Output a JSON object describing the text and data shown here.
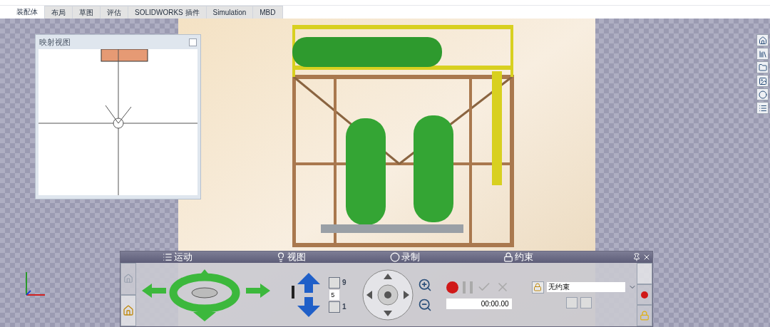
{
  "tabs": [
    {
      "label": "装配体",
      "selected": true
    },
    {
      "label": "布局",
      "selected": false
    },
    {
      "label": "草图",
      "selected": false
    },
    {
      "label": "评估",
      "selected": false
    },
    {
      "label": "SOLIDWORKS 插件",
      "selected": false
    },
    {
      "label": "Simulation",
      "selected": false
    },
    {
      "label": "MBD",
      "selected": false
    }
  ],
  "mapping_view": {
    "title": "映射视图"
  },
  "control_panel": {
    "sections": [
      {
        "label": "运动",
        "kind": "motion"
      },
      {
        "label": "视图",
        "kind": "view"
      },
      {
        "label": "录制",
        "kind": "record"
      },
      {
        "label": "约束",
        "kind": "lock"
      }
    ],
    "speed_fast": "9",
    "speed_value": "5",
    "speed_slow": "1",
    "timer": "00:00.00",
    "constraint": "无约束"
  }
}
